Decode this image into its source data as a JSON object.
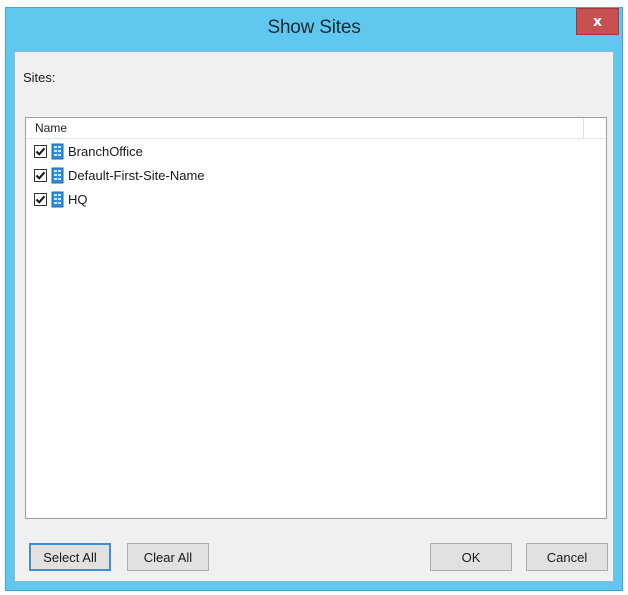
{
  "window": {
    "title": "Show Sites",
    "close_label": "x"
  },
  "sites_label": "Sites:",
  "list": {
    "columns": [
      "Name"
    ],
    "items": [
      {
        "label": "BranchOffice",
        "checked": true,
        "icon": "site-icon"
      },
      {
        "label": "Default-First-Site-Name",
        "checked": true,
        "icon": "site-icon"
      },
      {
        "label": "HQ",
        "checked": true,
        "icon": "site-icon"
      }
    ]
  },
  "buttons": {
    "select_all": "Select All",
    "clear_all": "Clear All",
    "ok": "OK",
    "cancel": "Cancel"
  },
  "colors": {
    "titlebar": "#60c7ee",
    "close": "#c75050",
    "client": "#f0f0f0",
    "site_icon": "#2f8ad8"
  }
}
